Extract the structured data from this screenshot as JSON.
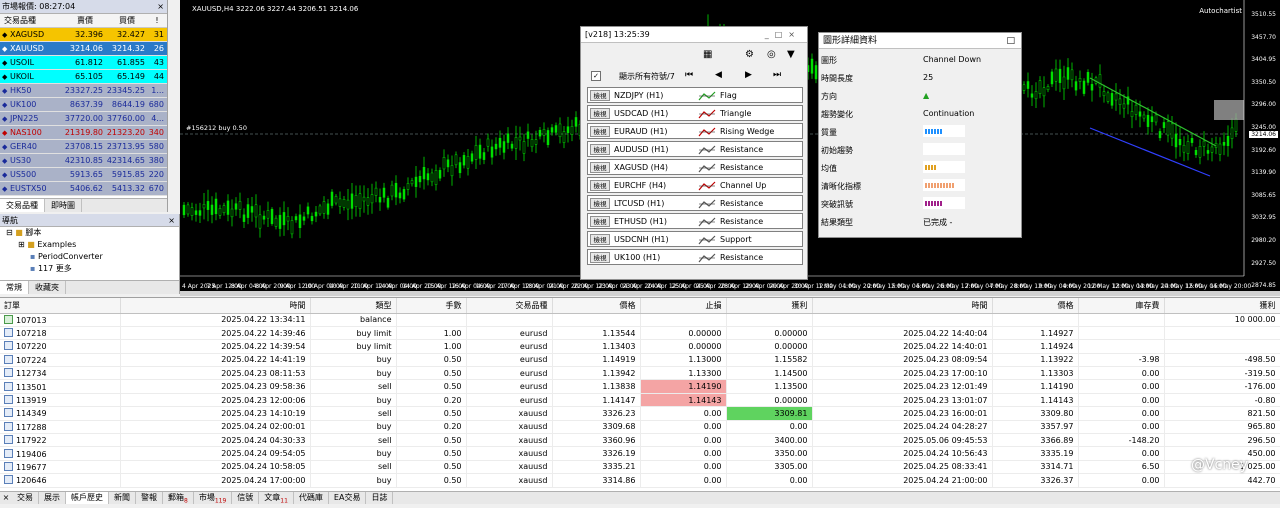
{
  "market_watch": {
    "title": "市場報價: 08:27:04",
    "headers": [
      "交易品種",
      "賣價",
      "買價",
      "!"
    ],
    "rows": [
      {
        "symbol": "XAGUSD",
        "bid": "32.396",
        "ask": "32.427",
        "spread": "31",
        "bg": "#f5c400",
        "fg": "#000000"
      },
      {
        "symbol": "XAUUSD",
        "bid": "3214.06",
        "ask": "3214.32",
        "spread": "26",
        "bg": "#2a7ac8",
        "fg": "#ffffff"
      },
      {
        "symbol": "USOIL",
        "bid": "61.812",
        "ask": "61.855",
        "spread": "43",
        "bg": "#00ffff",
        "fg": "#000000"
      },
      {
        "symbol": "UKOIL",
        "bid": "65.105",
        "ask": "65.149",
        "spread": "44",
        "bg": "#00ffff",
        "fg": "#000000"
      },
      {
        "symbol": "HK50",
        "bid": "23327.25",
        "ask": "23345.25",
        "spread": "1...",
        "bg": "#aab2c8",
        "fg": "#1a2a9a"
      },
      {
        "symbol": "UK100",
        "bid": "8637.39",
        "ask": "8644.19",
        "spread": "680",
        "bg": "#aab2c8",
        "fg": "#1a2a9a"
      },
      {
        "symbol": "JPN225",
        "bid": "37720.00",
        "ask": "37760.00",
        "spread": "4...",
        "bg": "#aab2c8",
        "fg": "#1a2a9a"
      },
      {
        "symbol": "NAS100",
        "bid": "21319.80",
        "ask": "21323.20",
        "spread": "340",
        "bg": "#aab2c8",
        "fg": "#c00000"
      },
      {
        "symbol": "GER40",
        "bid": "23708.15",
        "ask": "23713.95",
        "spread": "580",
        "bg": "#aab2c8",
        "fg": "#1a2a9a"
      },
      {
        "symbol": "US30",
        "bid": "42310.85",
        "ask": "42314.65",
        "spread": "380",
        "bg": "#aab2c8",
        "fg": "#1a2a9a"
      },
      {
        "symbol": "US500",
        "bid": "5913.65",
        "ask": "5915.85",
        "spread": "220",
        "bg": "#aab2c8",
        "fg": "#1a2a9a"
      },
      {
        "symbol": "EUSTX50",
        "bid": "5406.62",
        "ask": "5413.32",
        "spread": "670",
        "bg": "#aab2c8",
        "fg": "#1a2a9a"
      }
    ],
    "tabs": [
      "交易品種",
      "即時圖"
    ]
  },
  "navigator": {
    "title": "導航",
    "items": [
      "腳本",
      "Examples",
      "PeriodConverter",
      "117 更多"
    ],
    "tabs": [
      "常規",
      "收藏夾"
    ]
  },
  "chart": {
    "symbol_label": "XAUUSD,H4  3222.06 3227.44 3206.51 3214.06",
    "autochartist": "Autochartist",
    "order_label": "#156212 buy 0.50",
    "current_price": "3214.06",
    "price_ticks": [
      "3510.55",
      "3457.70",
      "3404.95",
      "3350.50",
      "3296.00",
      "3245.00",
      "3192.60",
      "3139.90",
      "3085.65",
      "3032.95",
      "2980.20",
      "2927.50",
      "2874.85"
    ],
    "time_ticks": [
      "4 Apr 2025",
      "7 Apr 12:00",
      "8 Apr 04:00",
      "8 Apr 20:00",
      "9 Apr 12:00",
      "10 Apr 04:00",
      "10 Apr 20:00",
      "11 Apr 12:00",
      "14 Apr 04:00",
      "14 Apr 20:00",
      "15 Apr 12:00",
      "16 Apr 04:00",
      "16 Apr 20:00",
      "17 Apr 12:00",
      "18 Apr 04:00",
      "21 Apr 20:00",
      "22 Apr 12:00",
      "23 Apr 04:00",
      "23 Apr 20:00",
      "24 Apr 12:00",
      "25 Apr 04:00",
      "25 Apr 20:00",
      "28 Apr 12:00",
      "29 Apr 04:00",
      "29 Apr 20:00",
      "30 Apr 12:00",
      "1 May 04:00",
      "1 May 20:00",
      "2 May 12:00",
      "5 May 04:00",
      "5 May 20:00",
      "6 May 12:00",
      "7 May 04:00",
      "7 May 20:00",
      "8 May 12:00",
      "9 May 04:00",
      "9 May 20:00",
      "12 May 12:00",
      "13 May 04:00",
      "13 May 20:00",
      "14 May 12:00",
      "15 May 04:00",
      "15 May 20:00"
    ]
  },
  "scanner": {
    "title": "[v218] 13:25:39",
    "show_all_label": "顯示所有符號/7",
    "view_label": "檢視",
    "rows": [
      {
        "symbol": "NZDJPY (H1)",
        "pattern": "Flag"
      },
      {
        "symbol": "USDCAD (H1)",
        "pattern": "Triangle"
      },
      {
        "symbol": "EURAUD (H1)",
        "pattern": "Rising Wedge"
      },
      {
        "symbol": "AUDUSD (H1)",
        "pattern": "Resistance"
      },
      {
        "symbol": "XAGUSD (H4)",
        "pattern": "Resistance"
      },
      {
        "symbol": "EURCHF (H4)",
        "pattern": "Channel Up"
      },
      {
        "symbol": "LTCUSD (H1)",
        "pattern": "Resistance"
      },
      {
        "symbol": "ETHUSD (H1)",
        "pattern": "Resistance"
      },
      {
        "symbol": "USDCNH (H1)",
        "pattern": "Support"
      },
      {
        "symbol": "UK100 (H1)",
        "pattern": "Resistance"
      }
    ]
  },
  "details": {
    "title": "圖形詳細資料",
    "rows": [
      {
        "key": "圖形",
        "value": "Channel Down"
      },
      {
        "key": "時間長度",
        "value": "25"
      },
      {
        "key": "方向",
        "value": "▲"
      },
      {
        "key": "趨勢變化",
        "value": "Continuation"
      },
      {
        "key": "質量",
        "value": ""
      },
      {
        "key": "初始趨勢",
        "value": ""
      },
      {
        "key": "均值",
        "value": ""
      },
      {
        "key": "清晰化指標",
        "value": ""
      },
      {
        "key": "突破訊號",
        "value": ""
      },
      {
        "key": "結果類型",
        "value": "已完成 -"
      }
    ],
    "bars": [
      {
        "row": 4,
        "color": "#1e90ff",
        "level": 0.6
      },
      {
        "row": 5,
        "color": "#ffffff",
        "level": 0
      },
      {
        "row": 6,
        "color": "#e0a020",
        "level": 0.4
      },
      {
        "row": 7,
        "color": "#f0a070",
        "level": 1.0
      },
      {
        "row": 8,
        "color": "#a0208a",
        "level": 0.6
      }
    ]
  },
  "history": {
    "headers": [
      "訂單",
      "時間",
      "類型",
      "手數",
      "交易品種",
      "價格",
      "止損",
      "獲利",
      "時間",
      "價格",
      "庫存費",
      "獲利"
    ],
    "rows": [
      {
        "c": [
          "107013",
          "2025.04.22 13:34:11",
          "balance",
          "",
          "",
          "",
          "",
          "",
          "",
          "",
          "",
          "10 000.00"
        ],
        "bal": true
      },
      {
        "c": [
          "107218",
          "2025.04.22 14:39:46",
          "buy limit",
          "1.00",
          "eurusd",
          "1.13544",
          "0.00000",
          "0.00000",
          "2025.04.22 14:40:04",
          "1.14927",
          "",
          ""
        ]
      },
      {
        "c": [
          "107220",
          "2025.04.22 14:39:54",
          "buy limit",
          "1.00",
          "eurusd",
          "1.13403",
          "0.00000",
          "0.00000",
          "2025.04.22 14:40:01",
          "1.14924",
          "",
          ""
        ]
      },
      {
        "c": [
          "107224",
          "2025.04.22 14:41:19",
          "buy",
          "0.50",
          "eurusd",
          "1.14919",
          "1.13000",
          "1.15582",
          "2025.04.23 08:09:54",
          "1.13922",
          "-3.98",
          "-498.50"
        ]
      },
      {
        "c": [
          "112734",
          "2025.04.23 08:11:53",
          "buy",
          "0.50",
          "eurusd",
          "1.13942",
          "1.13300",
          "1.14500",
          "2025.04.23 17:00:10",
          "1.13303",
          "0.00",
          "-319.50"
        ]
      },
      {
        "c": [
          "113501",
          "2025.04.23 09:58:36",
          "sell",
          "0.50",
          "eurusd",
          "1.13838",
          "1.14190",
          "1.13500",
          "2025.04.23 12:01:49",
          "1.14190",
          "0.00",
          "-176.00"
        ],
        "hl": 6,
        "hlc": "red"
      },
      {
        "c": [
          "113919",
          "2025.04.23 12:00:06",
          "buy",
          "0.20",
          "eurusd",
          "1.14147",
          "1.14143",
          "0.00000",
          "2025.04.23 13:01:07",
          "1.14143",
          "0.00",
          "-0.80"
        ],
        "hl": 6,
        "hlc": "red"
      },
      {
        "c": [
          "114349",
          "2025.04.23 14:10:19",
          "sell",
          "0.50",
          "xauusd",
          "3326.23",
          "0.00",
          "3309.81",
          "2025.04.23 16:00:01",
          "3309.80",
          "0.00",
          "821.50"
        ],
        "hl": 7,
        "hlc": "green"
      },
      {
        "c": [
          "117288",
          "2025.04.24 02:00:01",
          "buy",
          "0.20",
          "xauusd",
          "3309.68",
          "0.00",
          "0.00",
          "2025.04.24 04:28:27",
          "3357.97",
          "0.00",
          "965.80"
        ]
      },
      {
        "c": [
          "117922",
          "2025.04.24 04:30:33",
          "sell",
          "0.50",
          "xauusd",
          "3360.96",
          "0.00",
          "3400.00",
          "2025.05.06 09:45:53",
          "3366.89",
          "-148.20",
          "296.50"
        ]
      },
      {
        "c": [
          "119406",
          "2025.04.24 09:54:05",
          "buy",
          "0.50",
          "xauusd",
          "3326.19",
          "0.00",
          "3350.00",
          "2025.04.24 10:56:43",
          "3335.19",
          "0.00",
          "450.00"
        ]
      },
      {
        "c": [
          "119677",
          "2025.04.24 10:58:05",
          "sell",
          "0.50",
          "xauusd",
          "3335.21",
          "0.00",
          "3305.00",
          "2025.04.25 08:33:41",
          "3314.71",
          "6.50",
          "1 025.00"
        ]
      },
      {
        "c": [
          "120646",
          "2025.04.24 17:00:00",
          "buy",
          "0.50",
          "xauusd",
          "3314.86",
          "0.00",
          "0.00",
          "2025.04.24 21:00:00",
          "3326.37",
          "0.00",
          "442.70"
        ]
      }
    ]
  },
  "toolbox_tabs": [
    {
      "label": "交易",
      "badge": ""
    },
    {
      "label": "展示",
      "badge": ""
    },
    {
      "label": "帳戶歷史",
      "badge": "",
      "active": true
    },
    {
      "label": "新聞",
      "badge": ""
    },
    {
      "label": "警報",
      "badge": ""
    },
    {
      "label": "郵箱",
      "badge": "8"
    },
    {
      "label": "市場",
      "badge": "119"
    },
    {
      "label": "信號",
      "badge": ""
    },
    {
      "label": "文章",
      "badge": "11"
    },
    {
      "label": "代碼庫",
      "badge": ""
    },
    {
      "label": "EA交易",
      "badge": ""
    },
    {
      "label": "日誌",
      "badge": ""
    }
  ],
  "watermark": "@Vcney"
}
